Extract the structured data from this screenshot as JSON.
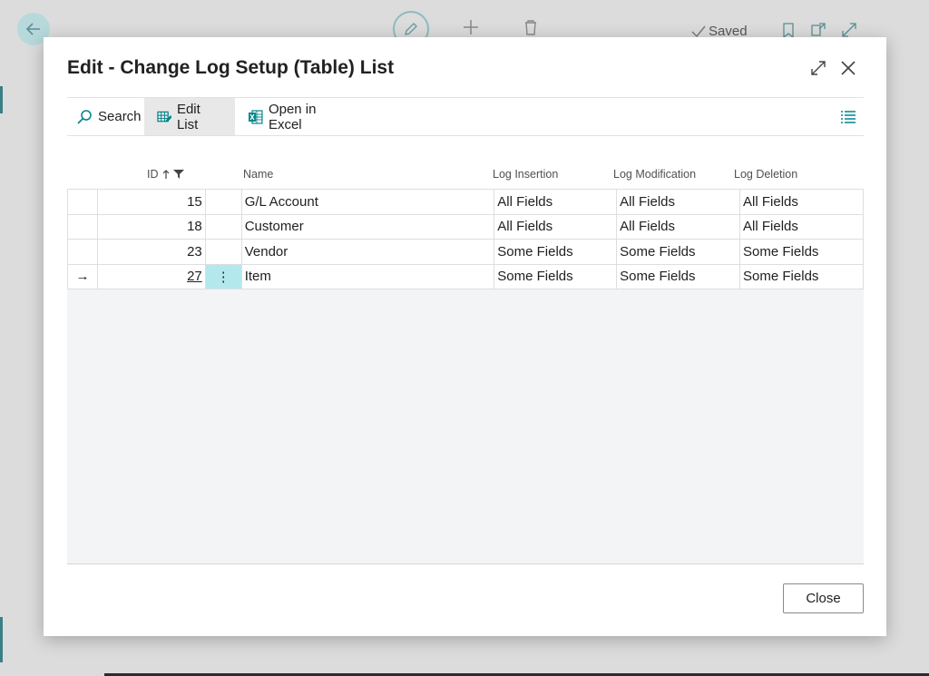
{
  "background": {
    "saved_label": "Saved",
    "icons": [
      "back-arrow-icon",
      "edit-pencil-icon",
      "plus-icon",
      "trash-icon",
      "checkmark-icon",
      "bookmark-icon",
      "open-new-window-icon",
      "expand-icon"
    ]
  },
  "dialog": {
    "title": "Edit - Change Log Setup (Table) List",
    "expand_icon": "expand-icon",
    "close_icon": "close-icon"
  },
  "actions": {
    "search_label": "Search",
    "edit_list_label": "Edit List",
    "open_excel_label": "Open in Excel",
    "view_icon": "list-view-icon"
  },
  "columns": {
    "id": "ID",
    "name": "Name",
    "log_insertion": "Log Insertion",
    "log_modification": "Log Modification",
    "log_deletion": "Log Deletion"
  },
  "rows": [
    {
      "indicator": "",
      "id": "15",
      "name": "G/L Account",
      "log_insertion": "All Fields",
      "log_modification": "All Fields",
      "log_deletion": "All Fields"
    },
    {
      "indicator": "",
      "id": "18",
      "name": "Customer",
      "log_insertion": "All Fields",
      "log_modification": "All Fields",
      "log_deletion": "All Fields"
    },
    {
      "indicator": "",
      "id": "23",
      "name": "Vendor",
      "log_insertion": "Some Fields",
      "log_modification": "Some Fields",
      "log_deletion": "Some Fields"
    },
    {
      "indicator": "→",
      "id": "27",
      "name": "Item",
      "log_insertion": "Some Fields",
      "log_modification": "Some Fields",
      "log_deletion": "Some Fields",
      "menu": "⋮"
    }
  ],
  "footer": {
    "close_label": "Close"
  },
  "colors": {
    "accent": "#008489",
    "active_cell": "#b3e8ed",
    "edit_list_bg": "#e8e8e8"
  }
}
